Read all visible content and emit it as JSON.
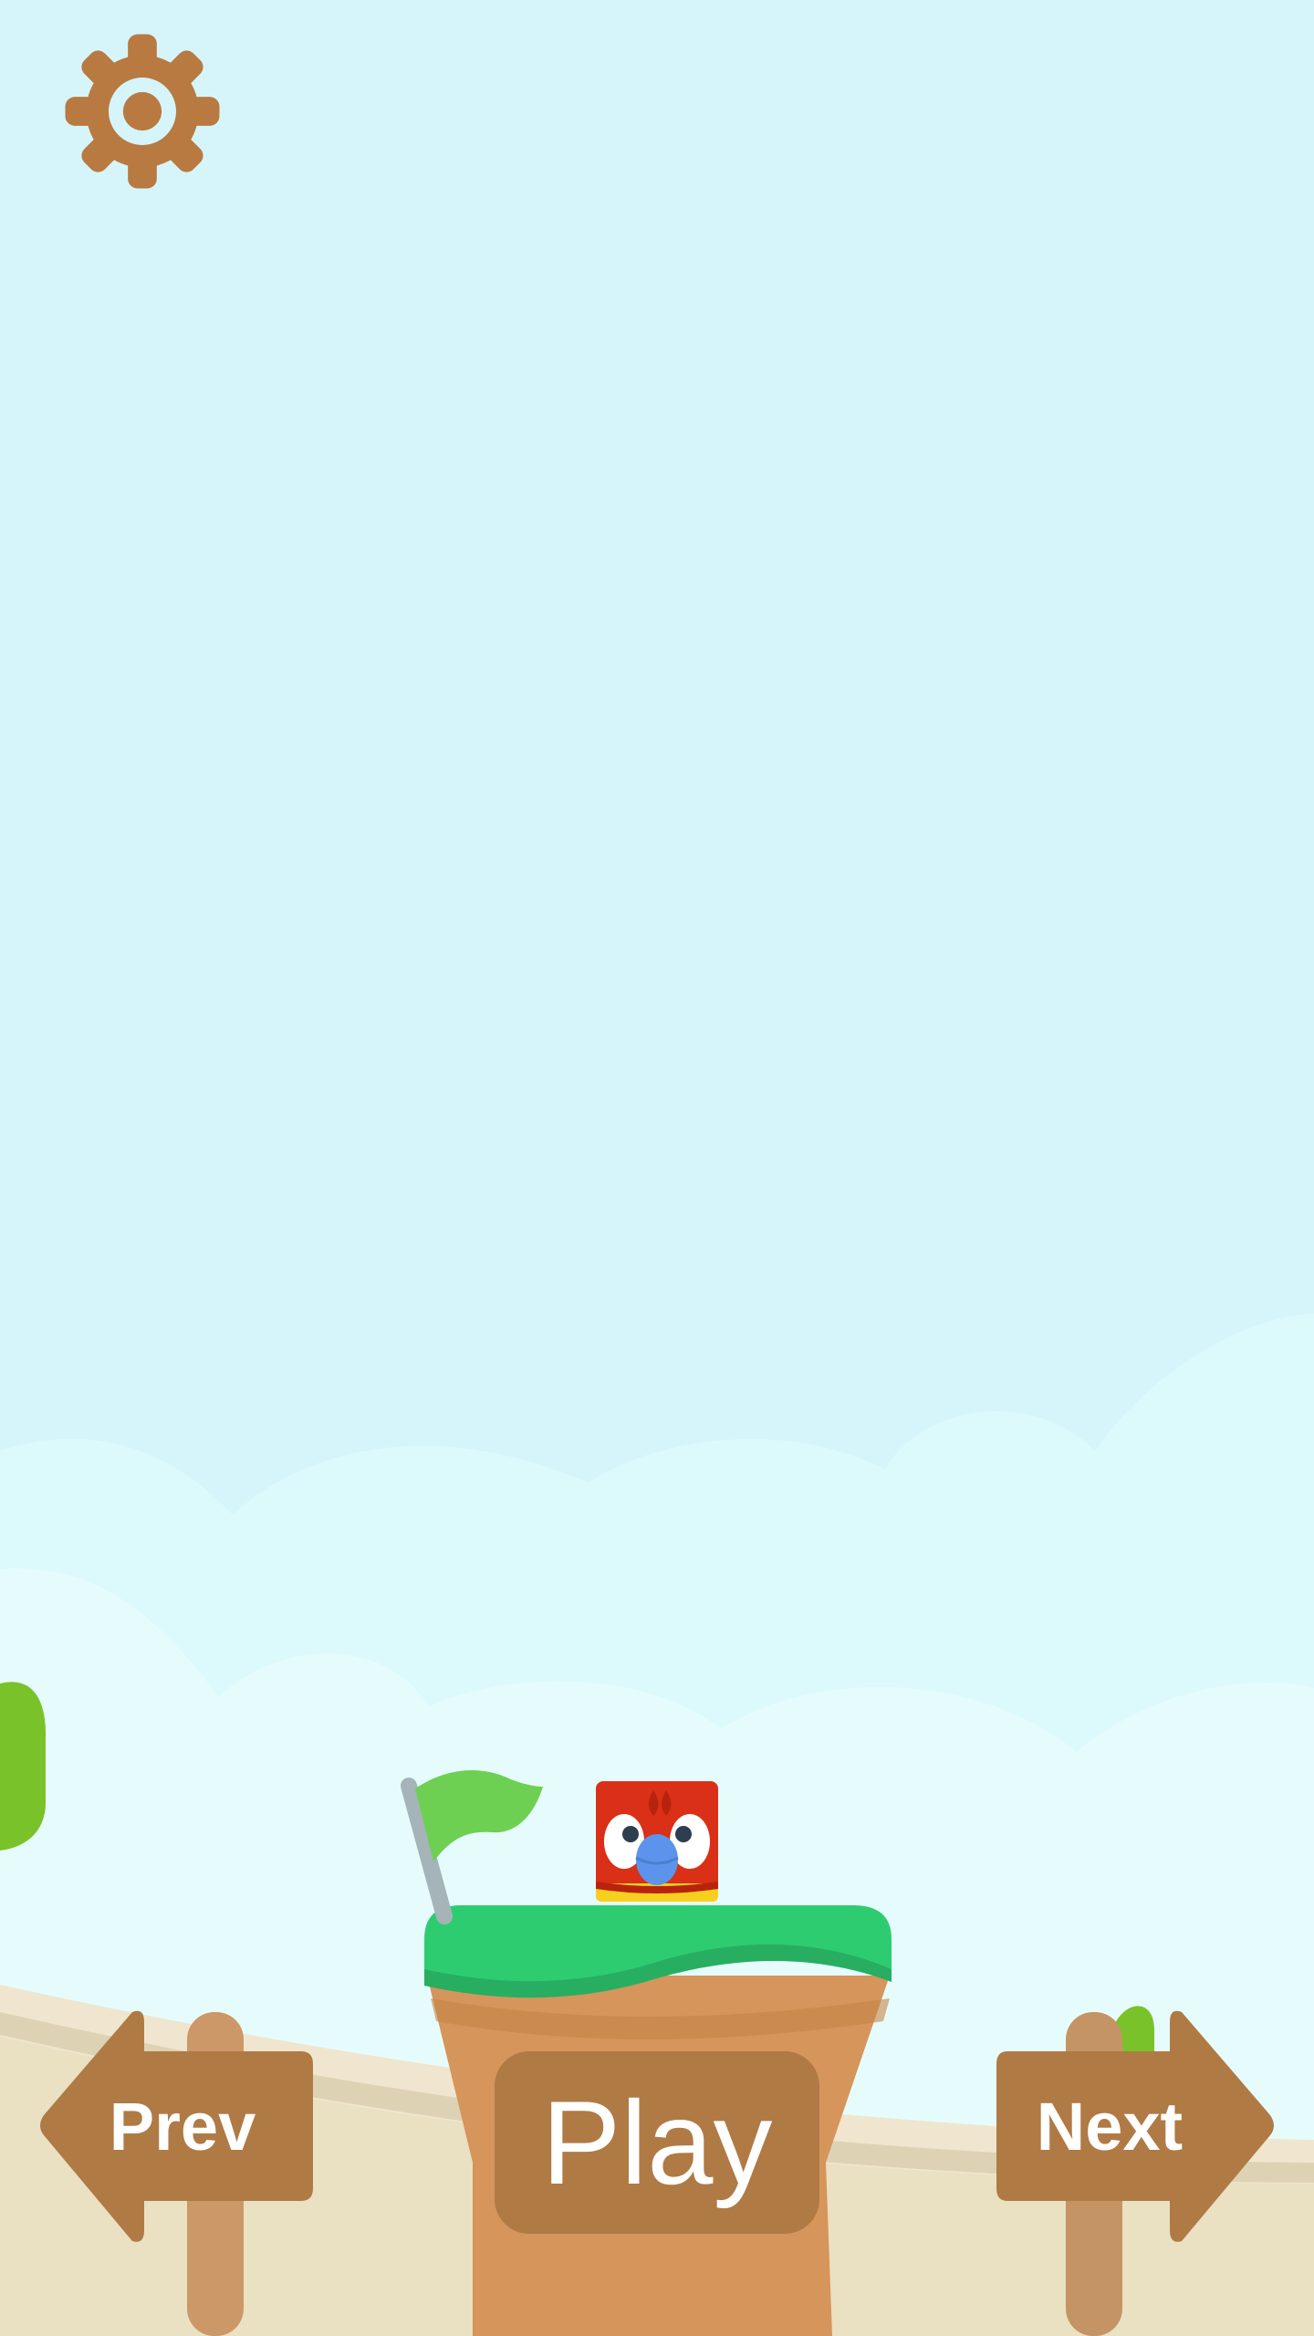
{
  "screen": {
    "sky_color": "#d5f5fb",
    "accent_brown": "#b07a45",
    "grass_green": "#2ecc71"
  },
  "toolbar": {
    "settings_icon": "gear-icon"
  },
  "navigation": {
    "prev_label": "Prev",
    "next_label": "Next",
    "play_label": "Play"
  },
  "scene": {
    "player_character": "red-parrot-block",
    "goal_marker": "green-flag-icon"
  }
}
